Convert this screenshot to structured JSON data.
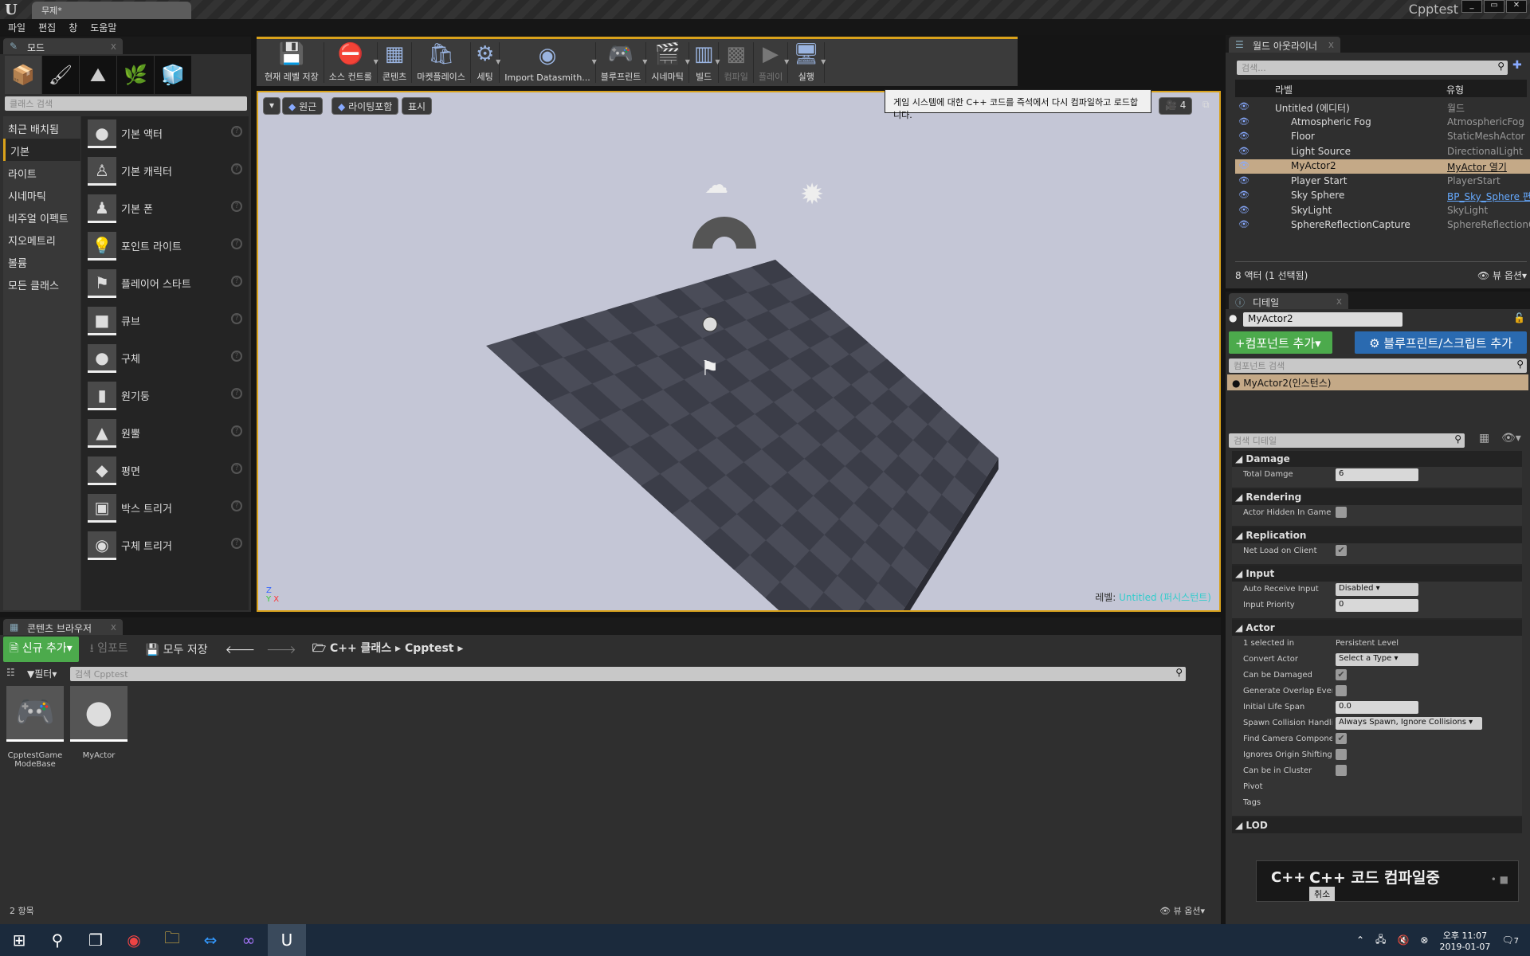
{
  "window": {
    "doc_tab": "무제*",
    "app_title": "Cpptest"
  },
  "menu": [
    "파일",
    "편집",
    "창",
    "도움말"
  ],
  "modes": {
    "tab": "모드",
    "search_placeholder": "클래스 검색",
    "categories": [
      "최근 배치됨",
      "기본",
      "라이트",
      "시네마틱",
      "비주얼 이펙트",
      "지오메트리",
      "볼륨",
      "모든 클래스"
    ],
    "selected_category": "기본",
    "items": [
      {
        "label": "기본 액터",
        "icon": "●"
      },
      {
        "label": "기본 캐릭터",
        "icon": "♙"
      },
      {
        "label": "기본 폰",
        "icon": "♟"
      },
      {
        "label": "포인트 라이트",
        "icon": "💡"
      },
      {
        "label": "플레이어 스타트",
        "icon": "⚑"
      },
      {
        "label": "큐브",
        "icon": "■"
      },
      {
        "label": "구체",
        "icon": "●"
      },
      {
        "label": "원기둥",
        "icon": "▮"
      },
      {
        "label": "원뿔",
        "icon": "▲"
      },
      {
        "label": "평면",
        "icon": "◆"
      },
      {
        "label": "박스 트리거",
        "icon": "▣"
      },
      {
        "label": "구체 트리거",
        "icon": "◉"
      }
    ]
  },
  "toolbar": [
    {
      "label": "현재 레벨 저장",
      "icon": "💾"
    },
    {
      "label": "소스 컨트롤",
      "icon": "⛔",
      "dd": true
    },
    {
      "label": "콘텐츠",
      "icon": "▦"
    },
    {
      "label": "마켓플레이스",
      "icon": "🛍"
    },
    {
      "label": "세팅",
      "icon": "⚙",
      "dd": true
    },
    {
      "label": "Import Datasmith...",
      "icon": "◉",
      "dd": true
    },
    {
      "label": "블루프린트",
      "icon": "🎮",
      "dd": true
    },
    {
      "label": "시네마틱",
      "icon": "🎬",
      "dd": true
    },
    {
      "label": "빌드",
      "icon": "▥",
      "dd": true
    },
    {
      "label": "컴파일",
      "icon": "▩",
      "disabled": true
    },
    {
      "label": "플레이",
      "icon": "▶",
      "dd": true,
      "disabled": true
    },
    {
      "label": "실행",
      "icon": "🖥",
      "dd": true
    }
  ],
  "viewport": {
    "perspective": "원근",
    "lighting": "라이팅포함",
    "show": "표시",
    "camera_speed": "4",
    "level_label": "레벨:",
    "level_name": "Untitled (퍼시스턴트)"
  },
  "tooltip": "게임 시스템에 대한 C++ 코드를 즉석에서 다시 컴파일하고 로드합니다.",
  "outliner": {
    "tab": "월드 아웃라이너",
    "search_placeholder": "검색...",
    "col_label": "라벨",
    "col_type": "유형",
    "rows": [
      {
        "name": "Untitled (에디터)",
        "type": "월드",
        "indent": 0
      },
      {
        "name": "Atmospheric Fog",
        "type": "AtmosphericFog",
        "indent": 1
      },
      {
        "name": "Floor",
        "type": "StaticMeshActor",
        "indent": 1
      },
      {
        "name": "Light Source",
        "type": "DirectionalLight",
        "indent": 1
      },
      {
        "name": "MyActor2",
        "type": "MyActor 열기",
        "indent": 1,
        "selected": true
      },
      {
        "name": "Player Start",
        "type": "PlayerStart",
        "indent": 1
      },
      {
        "name": "Sky Sphere",
        "type": "BP_Sky_Sphere 편집",
        "indent": 1,
        "link": true
      },
      {
        "name": "SkyLight",
        "type": "SkyLight",
        "indent": 1
      },
      {
        "name": "SphereReflectionCapture",
        "type": "SphereReflectionCapture",
        "indent": 1
      }
    ],
    "footer": "8 액터 (1 선택됨)",
    "view_options": "뷰 옵션"
  },
  "details": {
    "tab": "디테일",
    "actor_name": "MyActor2",
    "add_component": "컴포넌트 추가",
    "add_blueprint": "블루프린트/스크립트 추가",
    "component_search": "컴포넌트 검색",
    "component_instance": "MyActor2(인스턴스)",
    "search_placeholder": "검색 디테일",
    "sections": [
      {
        "title": "Damage",
        "rows": [
          {
            "label": "Total Damge",
            "kind": "num",
            "value": "6"
          }
        ]
      },
      {
        "title": "Rendering",
        "rows": [
          {
            "label": "Actor Hidden In Game",
            "kind": "chk",
            "value": false
          }
        ]
      },
      {
        "title": "Replication",
        "rows": [
          {
            "label": "Net Load on Client",
            "kind": "chk",
            "value": true
          }
        ]
      },
      {
        "title": "Input",
        "rows": [
          {
            "label": "Auto Receive Input",
            "kind": "combo",
            "value": "Disabled"
          },
          {
            "label": "Input Priority",
            "kind": "num",
            "value": "0"
          }
        ]
      },
      {
        "title": "Actor",
        "rows": [
          {
            "label": "1 selected in",
            "kind": "text",
            "value": "Persistent Level"
          },
          {
            "label": "Convert Actor",
            "kind": "combo",
            "value": "Select a Type"
          },
          {
            "label": "Can be Damaged",
            "kind": "chk",
            "value": true
          },
          {
            "label": "Generate Overlap Events",
            "kind": "chk",
            "value": false
          },
          {
            "label": "Initial Life Span",
            "kind": "num",
            "value": "0.0"
          },
          {
            "label": "Spawn Collision Handling",
            "kind": "combo",
            "value": "Always Spawn, Ignore Collisions"
          },
          {
            "label": "Find Camera Component",
            "kind": "chk",
            "value": true
          },
          {
            "label": "Ignores Origin Shifting",
            "kind": "chk",
            "value": false
          },
          {
            "label": "Can be in Cluster",
            "kind": "chk",
            "value": false
          },
          {
            "label": "Pivot",
            "kind": "text",
            "value": ""
          },
          {
            "label": "Tags",
            "kind": "text",
            "value": ""
          }
        ]
      },
      {
        "title": "LOD",
        "rows": []
      }
    ]
  },
  "content_browser": {
    "tab": "콘텐츠 브라우저",
    "add_new": "신규 추가",
    "import": "임포트",
    "save_all": "모두 저장",
    "path": [
      "C++ 클래스",
      "Cpptest"
    ],
    "filter": "필터",
    "search_placeholder": "검색 Cpptest",
    "assets": [
      {
        "name": "CpptestGame ModeBase",
        "icon": "🎮"
      },
      {
        "name": "MyActor",
        "icon": "●"
      }
    ],
    "count": "2 항목",
    "view_options": "뷰 옵션"
  },
  "compile_toast": {
    "title": "C++ 코드 컴파일중",
    "cancel": "취소",
    "logo": "C++"
  },
  "taskbar": {
    "time": "오후 11:07",
    "date": "2019-01-07",
    "notifications": "7"
  },
  "colors": {
    "accent": "#d9a21b",
    "add_green": "#4caa4c",
    "blueprint_blue": "#2a6ab0",
    "selection": "#c4a987"
  }
}
